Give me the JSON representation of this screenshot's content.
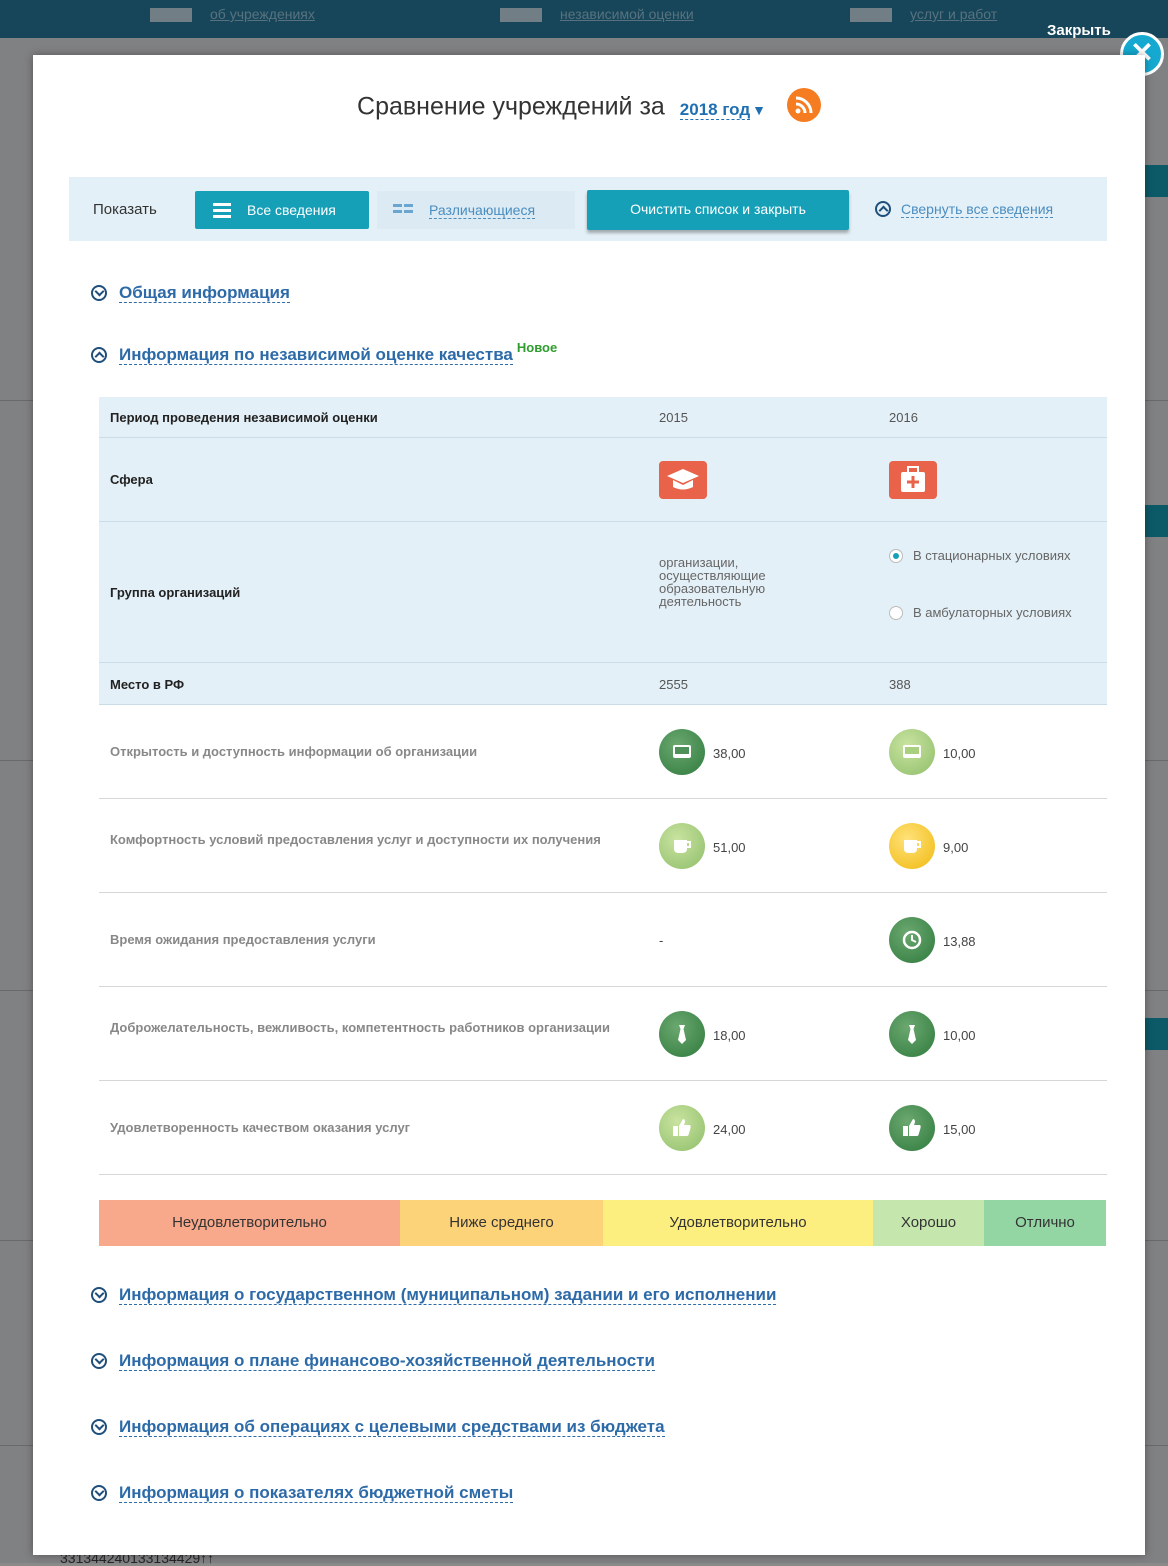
{
  "background": {
    "top_tabs": [
      "об учреждениях",
      "независимой оценки",
      "услуг и работ"
    ],
    "footer_text": "331344240133134429↑↑"
  },
  "close_link": "Закрыть",
  "modal": {
    "title": "Сравнение учреждений за",
    "year": "2018 год",
    "toolbar": {
      "show_label": "Показать",
      "all_label": "Все сведения",
      "diff_label": "Различающиеся",
      "clear_label": "Очистить список и закрыть",
      "collapse_label": "Свернуть все сведения"
    },
    "sections": {
      "general": "Общая информация",
      "quality": "Информация по независимой оценке качества",
      "new_badge": "Новое",
      "task": "Информация о государственном (муниципальном) задании и его исполнении",
      "plan": "Информация о плане финансово-хозяйственной деятельности",
      "ops": "Информация об операциях с целевыми средствами из бюджета",
      "budget": "Информация о показателях бюджетной сметы"
    },
    "table": {
      "period": {
        "label": "Период проведения независимой оценки",
        "c1": "2015",
        "c2": "2016"
      },
      "sphere": {
        "label": "Сфера",
        "c1_icon": "education-icon",
        "c2_icon": "medical-kit-icon"
      },
      "group": {
        "label": "Группа организаций",
        "c1": "организации, осуществляющие образовательную деятельность",
        "c2_options": [
          "В стационарных условиях",
          "В амбулаторных условиях"
        ],
        "c2_selected": 0
      },
      "place": {
        "label": "Место в РФ",
        "c1": "2555",
        "c2": "388"
      },
      "indicators": [
        {
          "label": "Открытость и доступность информации об организации",
          "icon": "info-board-icon",
          "c1": "38,00",
          "c1_rating": "dark-green",
          "c2": "10,00",
          "c2_rating": "light-green"
        },
        {
          "label": "Комфортность условий предоставления услуг и доступности их получения",
          "icon": "cup-icon",
          "c1": "51,00",
          "c1_rating": "light-green",
          "c2": "9,00",
          "c2_rating": "yellow"
        },
        {
          "label": "Время ожидания предоставления услуги",
          "icon": "clock-icon",
          "c1": "-",
          "c1_rating": "none",
          "c2": "13,88",
          "c2_rating": "dark-green"
        },
        {
          "label": "Доброжелательность, вежливость, компетентность работников организации",
          "icon": "tie-icon",
          "c1": "18,00",
          "c1_rating": "dark-green",
          "c2": "10,00",
          "c2_rating": "dark-green"
        },
        {
          "label": "Удовлетворенность качеством оказания услуг",
          "icon": "thumbs-up-icon",
          "c1": "24,00",
          "c1_rating": "light-green",
          "c2": "15,00",
          "c2_rating": "dark-green"
        }
      ]
    },
    "legend": [
      {
        "label": "Неудовлетворительно",
        "color": "#f9a98b"
      },
      {
        "label": "Ниже среднего",
        "color": "#fdd37a"
      },
      {
        "label": "Удовлетворительно",
        "color": "#fdef7f"
      },
      {
        "label": "Хорошо",
        "color": "#c5e6ad"
      },
      {
        "label": "Отлично",
        "color": "#93d6a4"
      }
    ]
  }
}
